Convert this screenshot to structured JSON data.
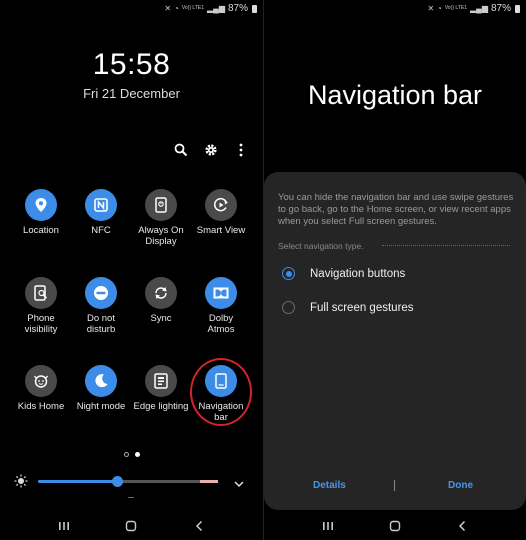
{
  "status": {
    "signal_label": "Vo)) LTE1",
    "battery": "87%"
  },
  "lock": {
    "time": "15:58",
    "date": "Fri 21 December"
  },
  "toolbar": {
    "search": "search-icon",
    "settings": "gear-icon",
    "more": "more-vert-icon"
  },
  "tiles": [
    {
      "label": "Location",
      "icon": "location-icon",
      "state": "on"
    },
    {
      "label": "NFC",
      "icon": "nfc-icon",
      "state": "on"
    },
    {
      "label": "Always On\nDisplay",
      "icon": "always-on-display-icon",
      "state": "off"
    },
    {
      "label": "Smart View",
      "icon": "smart-view-icon",
      "state": "off"
    },
    {
      "label": "Phone\nvisibility",
      "icon": "phone-visibility-icon",
      "state": "off"
    },
    {
      "label": "Do not\ndisturb",
      "icon": "do-not-disturb-icon",
      "state": "on"
    },
    {
      "label": "Sync",
      "icon": "sync-icon",
      "state": "off"
    },
    {
      "label": "Dolby\nAtmos",
      "icon": "dolby-icon",
      "state": "on"
    },
    {
      "label": "Kids Home",
      "icon": "kids-home-icon",
      "state": "off"
    },
    {
      "label": "Night mode",
      "icon": "night-mode-icon",
      "state": "on"
    },
    {
      "label": "Edge lighting",
      "icon": "edge-lighting-icon",
      "state": "off"
    },
    {
      "label": "Navigation\nbar",
      "icon": "navigation-bar-icon",
      "state": "on"
    }
  ],
  "pager": {
    "pages": 2,
    "current": 2
  },
  "brightness": {
    "level": 0.44
  },
  "nav_settings": {
    "title": "Navigation bar",
    "description": "You can hide the navigation bar and use swipe gestures to go back, go to the Home screen, or view recent apps when you select Full screen gestures.",
    "subheading": "Select navigation type.",
    "options": [
      {
        "label": "Navigation buttons",
        "selected": true
      },
      {
        "label": "Full screen gestures",
        "selected": false
      }
    ],
    "details_label": "Details",
    "done_label": "Done"
  },
  "colors": {
    "accent": "#3d8de8",
    "tile_off": "#4a4a4a",
    "highlight": "#d4242b",
    "sheet": "#252525"
  }
}
